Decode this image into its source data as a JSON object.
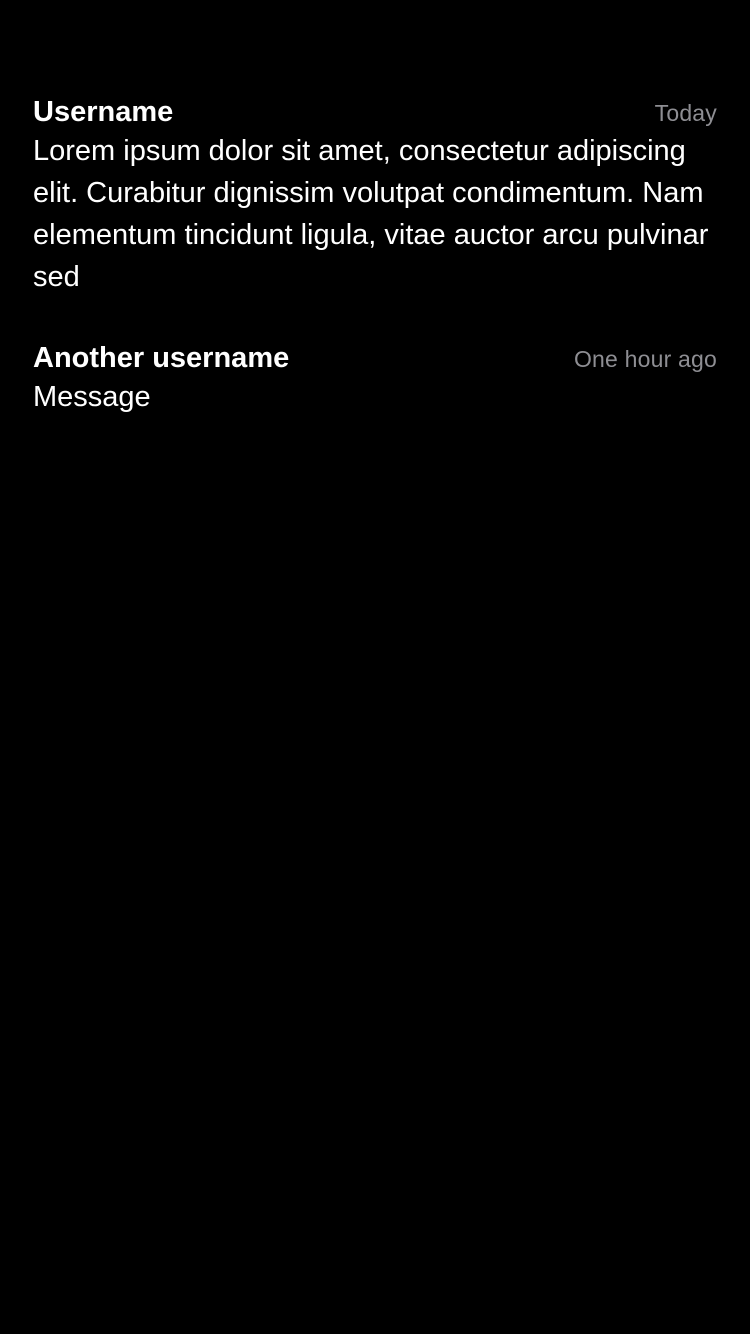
{
  "theme": {
    "background": "#000000",
    "text": "#ffffff",
    "secondary_text": "#8e8e93"
  },
  "messages": [
    {
      "username": "Username",
      "timestamp": "Today",
      "body": "Lorem ipsum dolor sit amet, consectetur adipiscing elit. Curabitur dignissim volutpat condimentum. Nam elementum tincidunt ligula, vitae auctor arcu pulvinar sed"
    },
    {
      "username": "Another username",
      "timestamp": "One hour ago",
      "body": "Message"
    }
  ]
}
